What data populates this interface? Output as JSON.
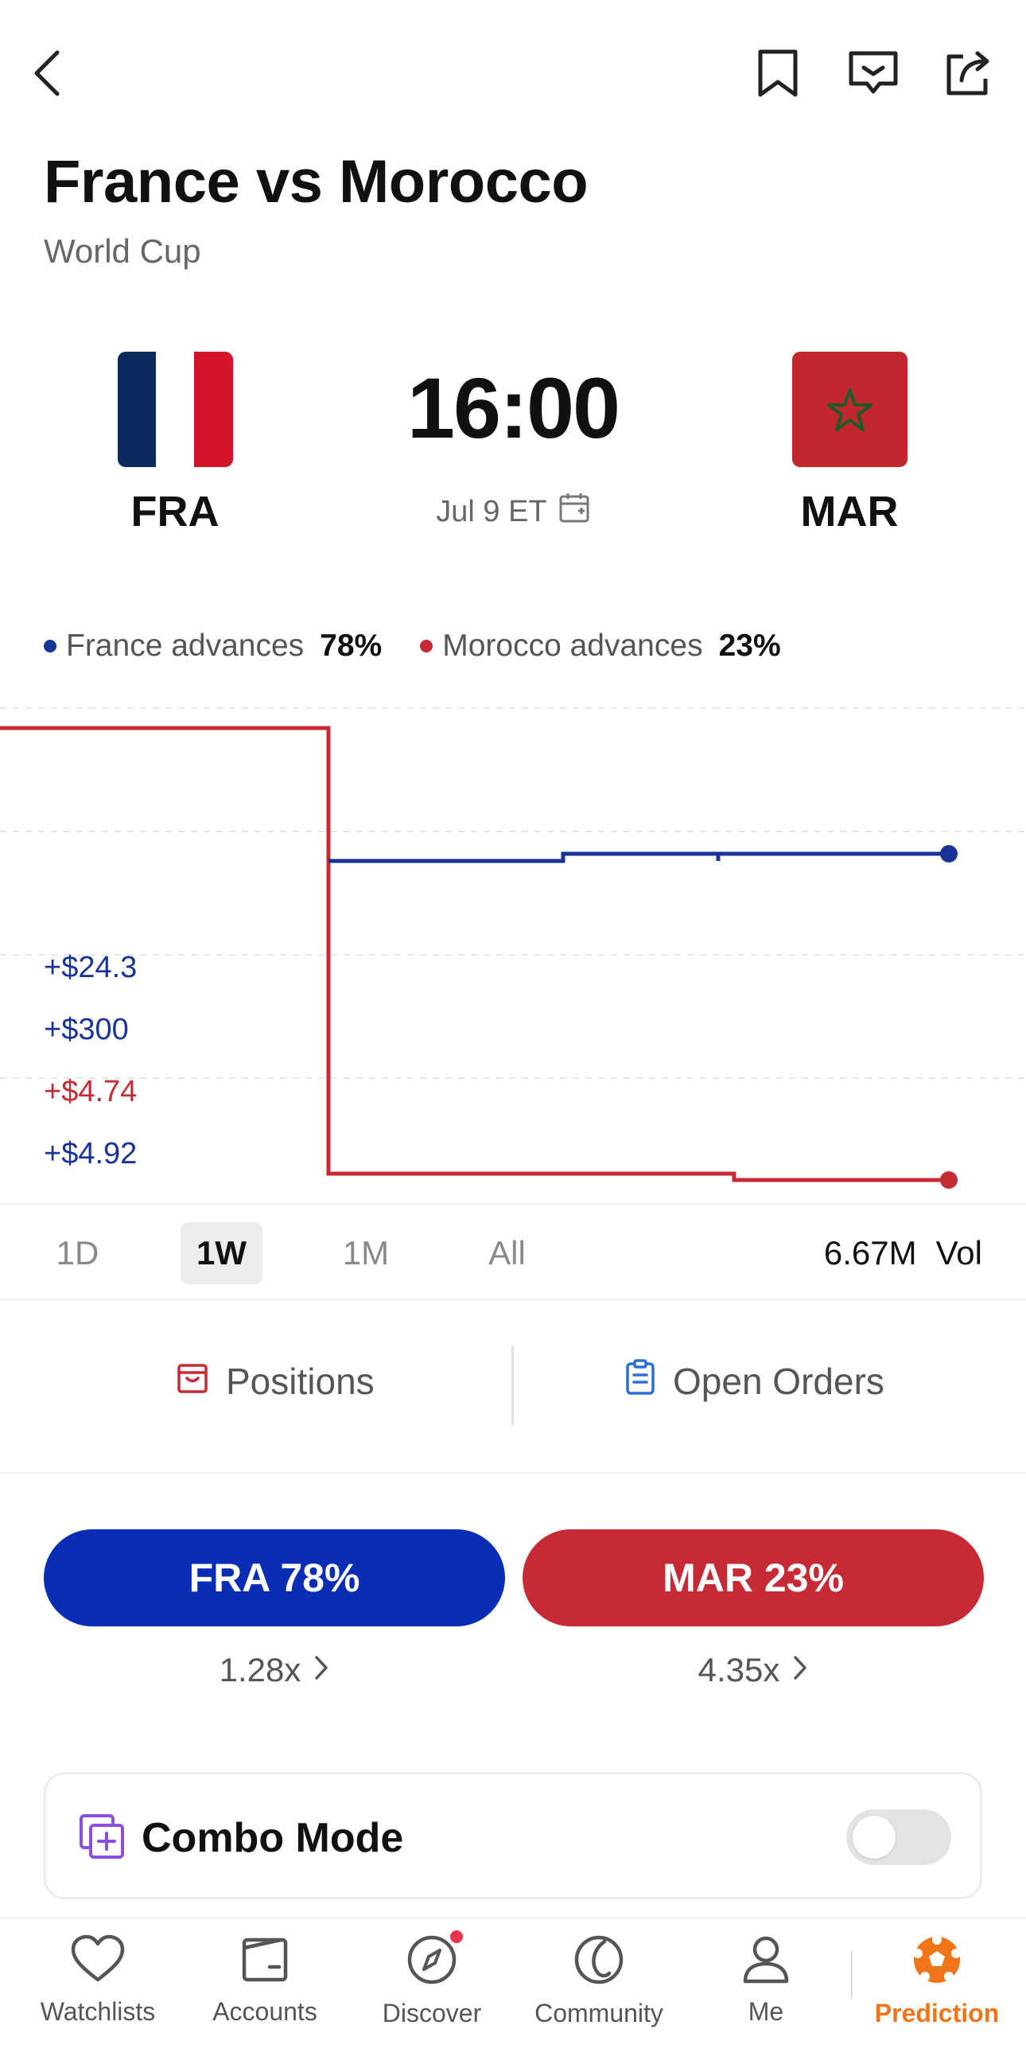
{
  "match": {
    "title": "France vs Morocco",
    "competition": "World Cup",
    "time": "16:00",
    "date": "Jul 9 ET",
    "home": {
      "code": "FRA"
    },
    "away": {
      "code": "MAR"
    }
  },
  "legend": {
    "home_label": "France advances",
    "home_pct": "78%",
    "away_label": "Morocco advances",
    "away_pct": "23%"
  },
  "pnl": {
    "rows": [
      "+$24.3",
      "+$300",
      "+$4.74",
      "+$4.92"
    ]
  },
  "chart_data": {
    "type": "line",
    "series": [
      {
        "name": "France advances",
        "last_value": 78,
        "color": "#1a3399"
      },
      {
        "name": "Morocco advances",
        "last_value": 23,
        "color": "#c62a35"
      }
    ]
  },
  "range": {
    "options": [
      "1D",
      "1W",
      "1M",
      "All"
    ],
    "selected": "1W",
    "volume_value": "6.67M",
    "volume_label": "Vol"
  },
  "tabs": {
    "positions": "Positions",
    "open_orders": "Open Orders"
  },
  "bet": {
    "home_label": "FRA 78%",
    "home_odds": "1.28x",
    "away_label": "MAR 23%",
    "away_odds": "4.35x"
  },
  "combo": {
    "label": "Combo Mode",
    "enabled": false
  },
  "nav": {
    "items": [
      "Watchlists",
      "Accounts",
      "Discover",
      "Community",
      "Me",
      "Prediction"
    ],
    "active": "Prediction"
  },
  "colors": {
    "home": "#0a2db5",
    "away": "#c62a35",
    "accent": "#f07418",
    "france_navy": "#0d2a5e",
    "france_red": "#d11427"
  }
}
